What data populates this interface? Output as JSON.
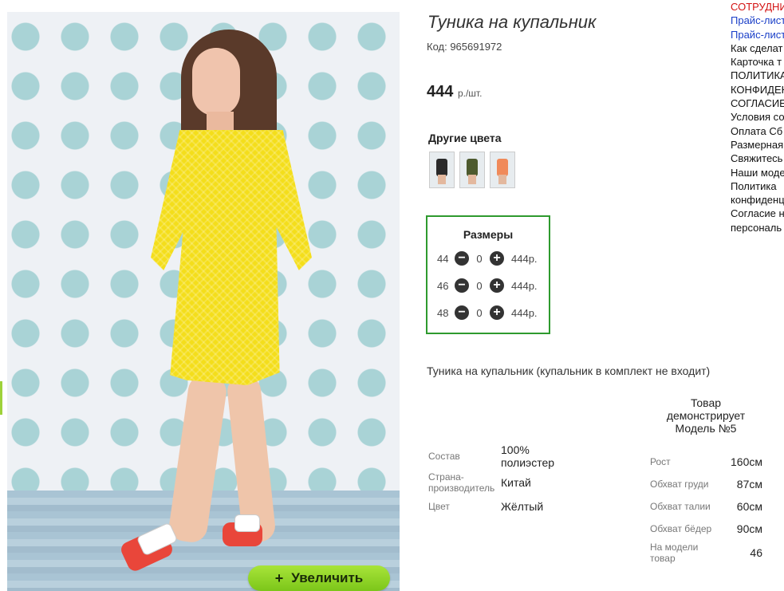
{
  "product": {
    "title": "Туника на купальник",
    "code": "Код: 965691972",
    "price": "444",
    "price_unit": "р./шт.",
    "description": "Туника на купальник (купальник в комплект не входит)",
    "zoom_button": "Увеличить",
    "zoom_plus": "+"
  },
  "other_colors": {
    "title": "Другие цвета",
    "thumbs": [
      {
        "color": "#2a2a2a"
      },
      {
        "color": "#4d5a2e"
      },
      {
        "color": "#f08a5a"
      }
    ]
  },
  "sizes": {
    "title": "Размеры",
    "minus_icon": "minus-circle-icon",
    "plus_icon": "plus-circle-icon",
    "rows": [
      {
        "size": "44",
        "qty": "0",
        "price": "444р."
      },
      {
        "size": "46",
        "qty": "0",
        "price": "444р."
      },
      {
        "size": "48",
        "qty": "0",
        "price": "444р."
      }
    ]
  },
  "specs": [
    {
      "label": "Состав",
      "value": "100% полиэстер"
    },
    {
      "label": "Страна-производитель",
      "value": "Китай"
    },
    {
      "label": "Цвет",
      "value": "Жёлтый"
    }
  ],
  "model": {
    "header": "Товар демонстрирует Модель №5",
    "measures": [
      {
        "label": "Рост",
        "value": "160см"
      },
      {
        "label": "Обхват груди",
        "value": "87см"
      },
      {
        "label": "Обхват талии",
        "value": "60см"
      },
      {
        "label": "Обхват бёдер",
        "value": "90см"
      },
      {
        "label": "На модели товар",
        "value": "46"
      }
    ]
  },
  "side_menu": [
    "СОТРУДНИ",
    "Прайс-лист",
    "Прайс-лист",
    "Как сделат",
    "Карточка т",
    "ПОЛИТИКА",
    "КОНФИДЕН",
    "СОГЛАСИЕ",
    "Условия со",
    "Оплата Сб",
    "Размерная",
    "Свяжитесь",
    "Наши моде",
    "Политика",
    "конфиденц",
    "Согласие н",
    "персональ"
  ],
  "colors": {
    "accent_green": "#2e9a2e",
    "zoom_button": "#8ed22a",
    "menu_red": "#d31212",
    "menu_blue": "#1a3fc8"
  }
}
